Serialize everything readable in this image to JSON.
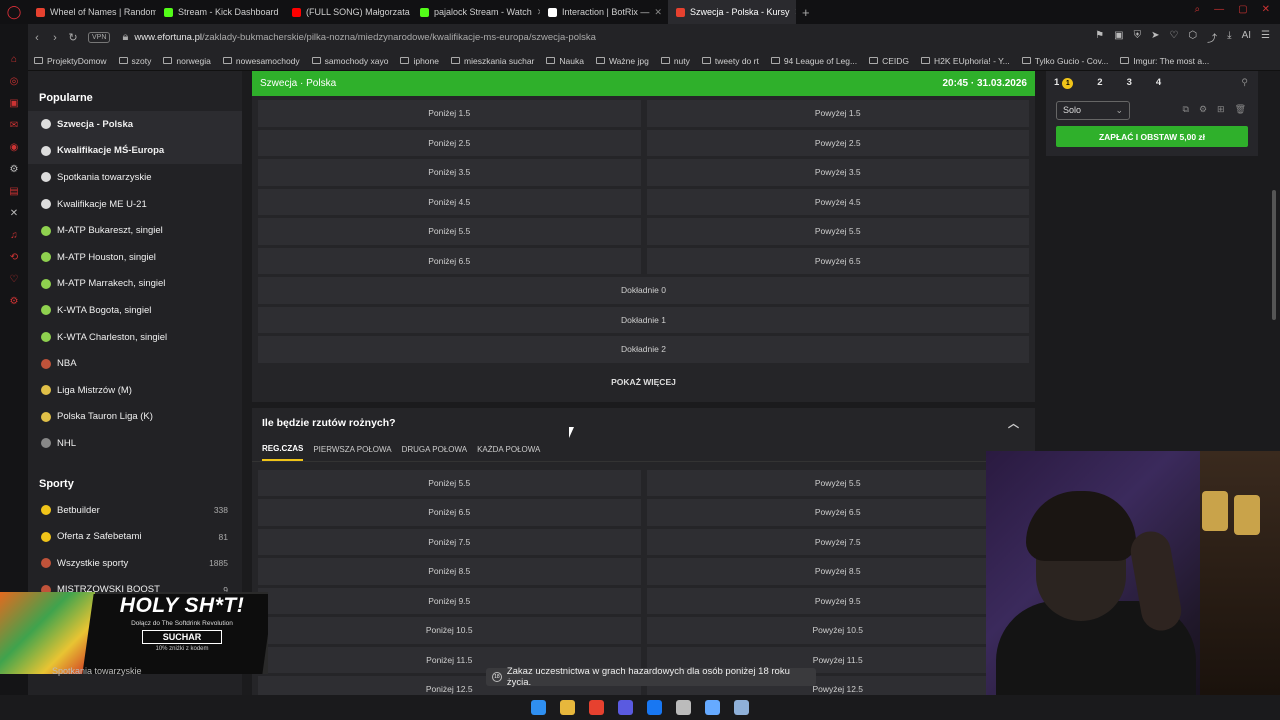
{
  "browser": {
    "tabs": [
      {
        "title": "Wheel of Names | Random",
        "color": "#e6412f"
      },
      {
        "title": "Stream - Kick Dashboard",
        "color": "#53fc18"
      },
      {
        "title": "(FULL SONG) Małgorzata",
        "color": "#ff0000"
      },
      {
        "title": "pajalock Stream - Watch",
        "color": "#53fc18"
      },
      {
        "title": "Interaction | BotRix —",
        "color": "#ffffff"
      },
      {
        "title": "Szwecja - Polska - Kursy",
        "color": "#e6412f"
      }
    ],
    "active_tab": 5,
    "vpn": "VPN",
    "url_host": "www.efortuna.pl",
    "url_path": "/zaklady-bukmacherskie/pilka-nozna/miedzynarodowe/kwalifikacje-ms-europa/szwecja-polska",
    "ai_label": "AI",
    "bookmarks": [
      "ProjektyDomow",
      "szoty",
      "norwegia",
      "nowesamochody",
      "samochody xayo",
      "iphone",
      "mieszkania suchar",
      "Nauka",
      "Ważne jpg",
      "nuty",
      "tweety do rt",
      "94 League of Leg...",
      "CEIDG",
      "H2K EUphoria! - Y...",
      "Tylko Gucio - Cov...",
      "Imgur: The most a..."
    ]
  },
  "sidebar": {
    "popular_title": "Popularne",
    "popular": [
      {
        "label": "Szwecja - Polska",
        "ball": "#dddddd"
      },
      {
        "label": "Kwalifikacje MŚ-Europa",
        "ball": "#dddddd"
      },
      {
        "label": "Spotkania towarzyskie",
        "ball": "#dddddd"
      },
      {
        "label": "Kwalifikacje ME U-21",
        "ball": "#dddddd"
      },
      {
        "label": "M-ATP Bukareszt, singiel",
        "ball": "#8fd14f"
      },
      {
        "label": "M-ATP Houston, singiel",
        "ball": "#8fd14f"
      },
      {
        "label": "M-ATP Marrakech, singiel",
        "ball": "#8fd14f"
      },
      {
        "label": "K-WTA Bogota, singiel",
        "ball": "#8fd14f"
      },
      {
        "label": "K-WTA Charleston, singiel",
        "ball": "#8fd14f"
      },
      {
        "label": "NBA",
        "ball": "#c0533a"
      },
      {
        "label": "Liga Mistrzów (M)",
        "ball": "#e0c048"
      },
      {
        "label": "Polska Tauron Liga (K)",
        "ball": "#e0c048"
      },
      {
        "label": "NHL",
        "ball": "#888888"
      }
    ],
    "sports_title": "Sporty",
    "sports": [
      {
        "label": "Betbuilder",
        "count": "338",
        "ball": "#f0c419"
      },
      {
        "label": "Oferta z Safebetami",
        "count": "81",
        "ball": "#f0c419"
      },
      {
        "label": "Wszystkie sporty",
        "count": "1885",
        "ball": "#c0533a"
      },
      {
        "label": "MISTRZOWSKI BOOST",
        "count": "9",
        "ball": "#c0533a"
      }
    ]
  },
  "match": {
    "teams": "Szwecja · Polska",
    "datetime": "20:45 · 31.03.2026"
  },
  "market1": {
    "rows": [
      [
        "Poniżej 1.5",
        "Powyżej 1.5"
      ],
      [
        "Poniżej 2.5",
        "Powyżej 2.5"
      ],
      [
        "Poniżej 3.5",
        "Powyżej 3.5"
      ],
      [
        "Poniżej 4.5",
        "Powyżej 4.5"
      ],
      [
        "Poniżej 5.5",
        "Powyżej 5.5"
      ],
      [
        "Poniżej 6.5",
        "Powyżej 6.5"
      ]
    ],
    "exact": [
      "Dokładnie 0",
      "Dokładnie 1",
      "Dokładnie 2"
    ],
    "more": "POKAŻ WIĘCEJ"
  },
  "market2": {
    "title": "Ile będzie rzutów rożnych?",
    "tabs": [
      "REG.CZAS",
      "PIERWSZA POŁOWA",
      "DRUGA POŁOWA",
      "KAŻDA POŁOWA"
    ],
    "rows": [
      [
        "Poniżej 5.5",
        "Powyżej 5.5"
      ],
      [
        "Poniżej 6.5",
        "Powyżej 6.5"
      ],
      [
        "Poniżej 7.5",
        "Powyżej 7.5"
      ],
      [
        "Poniżej 8.5",
        "Powyżej 8.5"
      ],
      [
        "Poniżej 9.5",
        "Powyżej 9.5"
      ],
      [
        "Poniżej 10.5",
        "Powyżej 10.5"
      ],
      [
        "Poniżej 11.5",
        "Powyżej 11.5"
      ],
      [
        "Poniżej 12.5",
        "Powyżej 12.5"
      ]
    ]
  },
  "betslip": {
    "tabs": [
      "1",
      "2",
      "3",
      "4"
    ],
    "badge": "1",
    "mode": "Solo",
    "button": "ZAPŁAĆ I OBSTAW 5,00 zł"
  },
  "ad": {
    "title": "HOLY SH*T!",
    "subtitle": "Dołącz do The Softdrink Revolution",
    "code": "SUCHAR",
    "discount": "10% zniżki z kodem",
    "below": "Spotkania towarzyskie"
  },
  "notice": {
    "age": "18",
    "text": "Zakaz uczestnictwa w grach hazardowych dla osób poniżej 18 roku życia."
  },
  "taskbar": [
    "#2f8ff0",
    "#e7b73c",
    "#e6412f",
    "#5a5ae0",
    "#1877f2",
    "#bbbbbb",
    "#66aaff",
    "#8fb0d8"
  ]
}
